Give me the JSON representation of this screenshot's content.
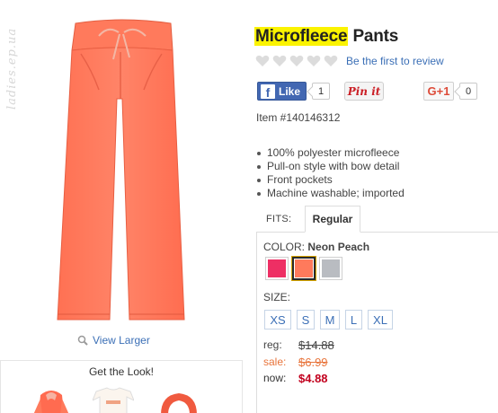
{
  "watermark": "ladies.ep.ua",
  "product": {
    "title_highlight": "Microfleece",
    "title_rest": " Pants",
    "rating": {
      "filled": 0,
      "max": 5
    },
    "review_link": "Be the first to review",
    "item_number": "Item #140146312",
    "features": [
      "100% polyester microfleece",
      "Pull-on style with bow detail",
      "Front pockets",
      "Machine washable; imported"
    ],
    "view_larger": "View Larger"
  },
  "social": {
    "fb_label": "Like",
    "fb_count": "1",
    "pin_label": "Pin it",
    "gplus_label": "G+1",
    "gplus_count": "0"
  },
  "fits": {
    "label": "FITS:",
    "selected": "Regular"
  },
  "color": {
    "label": "COLOR:",
    "selected_name": "Neon Peach",
    "swatches": [
      {
        "name": "pink",
        "hex": "#ee2f64"
      },
      {
        "name": "neon peach",
        "hex": "#ff7a5c",
        "selected": true
      },
      {
        "name": "gray",
        "hex": "#b9bcc1"
      }
    ]
  },
  "size": {
    "label": "SIZE:",
    "options": [
      "XS",
      "S",
      "M",
      "L",
      "XL"
    ]
  },
  "price": {
    "reg_label": "reg:",
    "reg_value": "$14.88",
    "sale_label": "sale:",
    "sale_value": "$6.99",
    "now_label": "now:",
    "now_value": "$4.88"
  },
  "get_the_look": {
    "title": "Get the Look!"
  },
  "colors": {
    "product": "#ff7a5c",
    "link": "#3b6fb6",
    "highlight": "#fbf300",
    "price_now": "#c2001e",
    "sale": "#e8743b"
  }
}
